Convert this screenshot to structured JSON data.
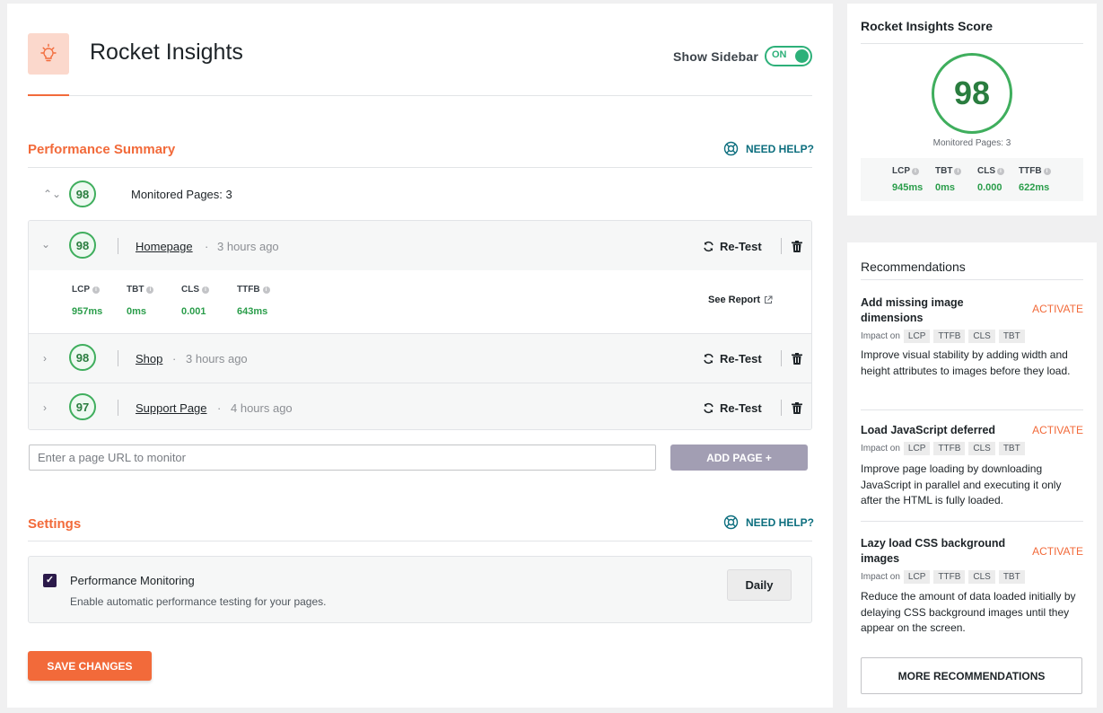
{
  "header": {
    "title": "Rocket Insights",
    "logo_icon": "lightbulb-icon",
    "sidebar_toggle_label": "Show Sidebar",
    "sidebar_toggle_state": "ON"
  },
  "colors": {
    "accent": "#f26a3a",
    "success": "#2db079",
    "help": "#0c6e7e",
    "add_button": "#a29eb3"
  },
  "performance": {
    "title": "Performance Summary",
    "help_label": "NEED HELP?",
    "summary_score": "98",
    "summary_label": "Monitored Pages: 3",
    "pages": [
      {
        "score": "98",
        "name": "Homepage",
        "sep": "·",
        "time": "3 hours ago",
        "retest": "Re-Test",
        "expanded": true,
        "metrics": [
          {
            "label": "LCP",
            "value": "957ms"
          },
          {
            "label": "TBT",
            "value": "0ms"
          },
          {
            "label": "CLS",
            "value": "0.001"
          },
          {
            "label": "TTFB",
            "value": "643ms"
          }
        ],
        "see_report": "See Report"
      },
      {
        "score": "98",
        "name": "Shop",
        "sep": "·",
        "time": "3 hours ago",
        "retest": "Re-Test",
        "expanded": false
      },
      {
        "score": "97",
        "name": "Support Page",
        "sep": "·",
        "time": "4 hours ago",
        "retest": "Re-Test",
        "expanded": false
      }
    ],
    "url_placeholder": "Enter a page URL to monitor",
    "add_page_label": "ADD PAGE +"
  },
  "settings": {
    "title": "Settings",
    "help_label": "NEED HELP?",
    "monitoring_title": "Performance Monitoring",
    "monitoring_desc": "Enable automatic performance testing for your pages.",
    "monitoring_checked": true,
    "frequency": "Daily",
    "save_label": "SAVE CHANGES"
  },
  "sidebar": {
    "score_title": "Rocket Insights Score",
    "score": "98",
    "monitored": "Monitored Pages: 3",
    "metrics": [
      {
        "label": "LCP",
        "value": "945ms"
      },
      {
        "label": "TBT",
        "value": "0ms"
      },
      {
        "label": "CLS",
        "value": "0.000"
      },
      {
        "label": "TTFB",
        "value": "622ms"
      }
    ],
    "recommendations_title": "Recommendations",
    "impact_label": "Impact on",
    "recommendations": [
      {
        "title": "Add missing image dimensions",
        "action": "ACTIVATE",
        "tags": [
          "LCP",
          "TTFB",
          "CLS",
          "TBT"
        ],
        "desc": "Improve visual stability by adding width and height attributes to images before they load."
      },
      {
        "title": "Load JavaScript deferred",
        "action": "ACTIVATE",
        "tags": [
          "LCP",
          "TTFB",
          "CLS",
          "TBT"
        ],
        "desc": "Improve page loading by downloading JavaScript in parallel and executing it only after the HTML is fully loaded."
      },
      {
        "title": "Lazy load CSS background images",
        "action": "ACTIVATE",
        "tags": [
          "LCP",
          "TTFB",
          "CLS",
          "TBT"
        ],
        "desc": "Reduce the amount of data loaded initially by delaying CSS background images until they appear on the screen."
      }
    ],
    "more_label": "MORE RECOMMENDATIONS"
  }
}
